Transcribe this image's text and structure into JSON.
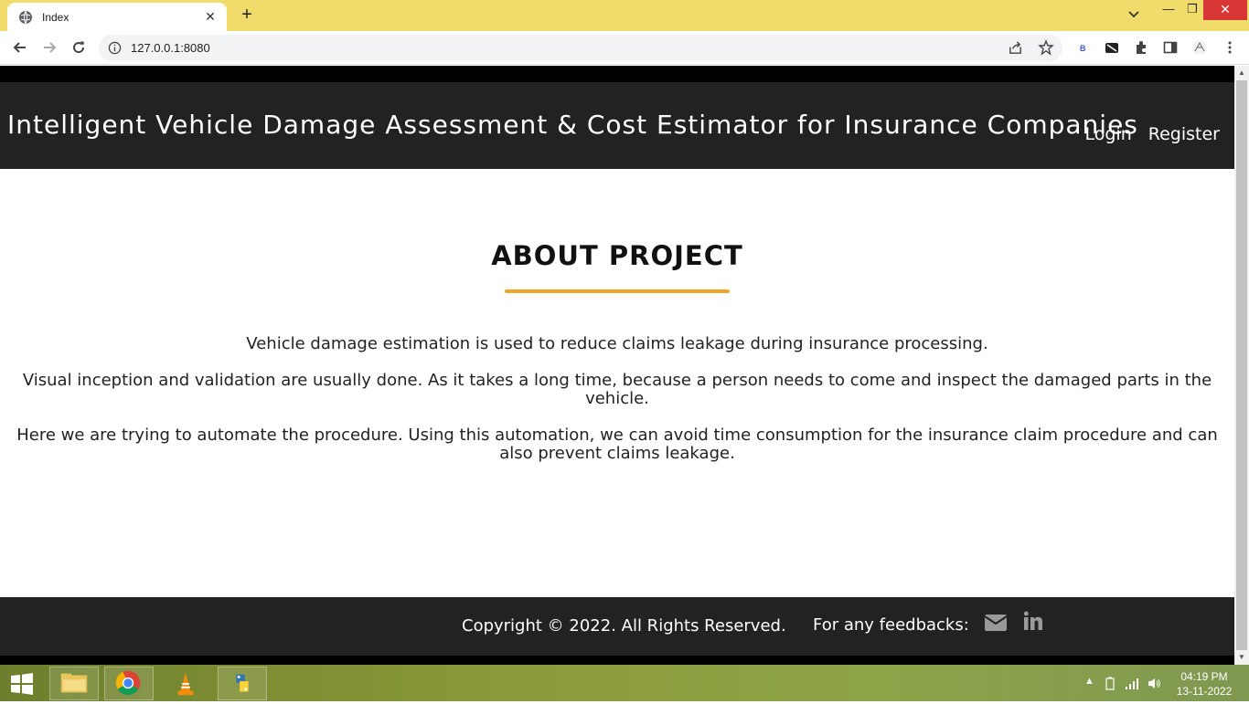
{
  "browser": {
    "tab_title": "Index",
    "url": "127.0.0.1:8080"
  },
  "site": {
    "title": "Intelligent Vehicle Damage Assessment & Cost Estimator for Insurance Companies",
    "nav": {
      "login": "Login",
      "register": "Register"
    }
  },
  "about": {
    "heading": "ABOUT PROJECT",
    "paragraphs": [
      "Vehicle damage estimation is used to reduce claims leakage during insurance processing.",
      "Visual inception and validation are usually done. As it takes a long time, because a person needs to come and inspect the damaged parts in the vehicle.",
      "Here we are trying to automate the procedure. Using this automation, we can avoid time consumption for the insurance claim procedure and can also prevent claims leakage."
    ],
    "accent_color": "#f0a52a"
  },
  "footer": {
    "copyright": "Copyright © 2022. All Rights Reserved.",
    "feedback": "For any feedbacks:",
    "icons": [
      "envelope-icon",
      "linkedin-icon"
    ]
  },
  "taskbar": {
    "time": "04:19 PM",
    "date": "13-11-2022",
    "apps": [
      "file-explorer-icon",
      "chrome-icon",
      "vlc-icon",
      "python-icon"
    ]
  },
  "colors": {
    "tabbar": "#f1dc6b",
    "header_bg": "#222222",
    "close_button": "#d93636"
  }
}
